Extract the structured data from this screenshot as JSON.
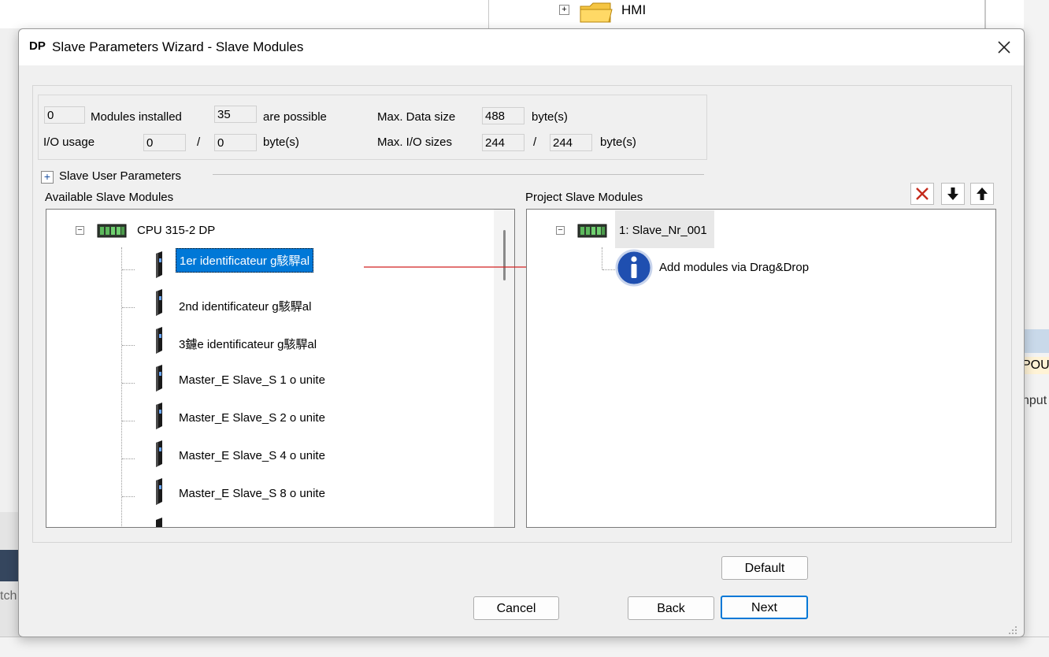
{
  "background": {
    "hmi_label": "HMI",
    "right_tab_label": "POU",
    "right_input_label": "nput",
    "left_label": "tch"
  },
  "dialog": {
    "title_icon": "DP",
    "title": "Slave Parameters Wizard - Slave Modules",
    "close_icon": "close-icon",
    "info": {
      "modules_installed_value": "0",
      "modules_installed_label": "Modules installed",
      "possible_value": "35",
      "possible_label": "are possible",
      "max_data_size_label": "Max. Data size",
      "max_data_size_value": "488",
      "max_data_size_unit": "byte(s)",
      "io_usage_label": "I/O usage",
      "io_usage_in": "0",
      "io_usage_sep": "/",
      "io_usage_out": "0",
      "io_usage_unit": "byte(s)",
      "max_io_label": "Max. I/O sizes",
      "max_io_in": "244",
      "max_io_sep": "/",
      "max_io_out": "244",
      "max_io_unit": "byte(s)"
    },
    "slave_user_params": {
      "expand_symbol": "+",
      "label": "Slave User Parameters"
    },
    "available": {
      "header": "Available Slave Modules",
      "root": "CPU 315-2 DP",
      "items": [
        "1er identificateur g駭駻al",
        "2nd identificateur g駭駻al",
        "3鑢e identificateur g駭駻al",
        "Master_E Slave_S  1 o unite",
        "Master_E Slave_S  2 o unite",
        "Master_E Slave_S  4 o unite",
        "Master_E Slave_S  8 o unite"
      ]
    },
    "project": {
      "header": "Project Slave Modules",
      "root": "1: Slave_Nr_001",
      "hint": "Add modules via Drag&Drop",
      "toolbar": [
        "delete-icon",
        "move-down-icon",
        "move-up-icon"
      ]
    },
    "buttons": {
      "default": "Default",
      "cancel": "Cancel",
      "back": "Back",
      "next": "Next"
    },
    "colors": {
      "selection": "#0078d7",
      "arrow": "#d22222",
      "delete": "#c42b1c"
    }
  }
}
